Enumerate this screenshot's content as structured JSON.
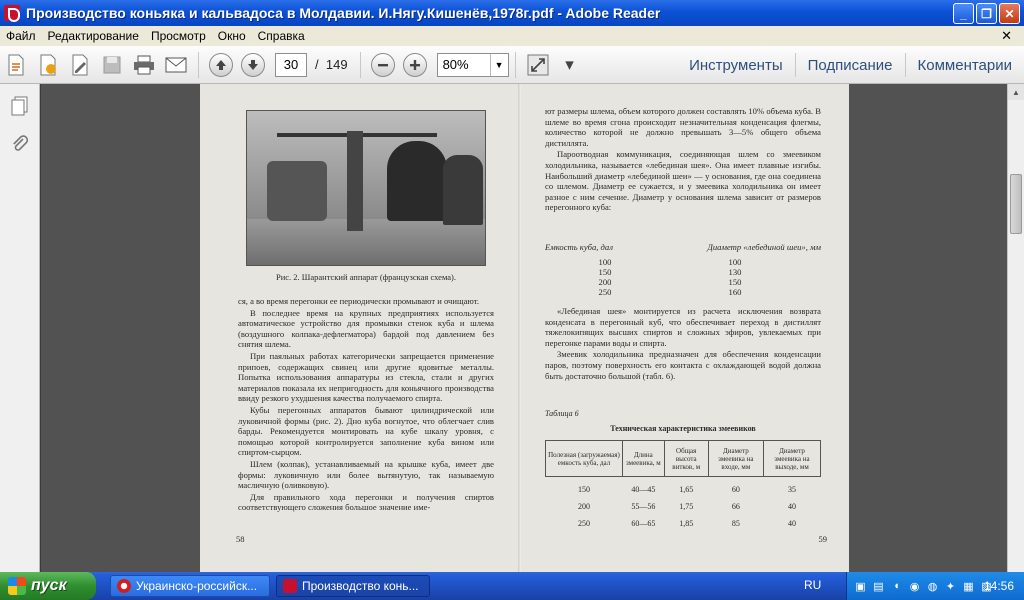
{
  "window": {
    "title": "Производство коньяка и кальвадоса в Молдавии. И.Нягу.Кишенёв,1978г.pdf - Adobe Reader",
    "min_glyph": "_",
    "max_glyph": "❐",
    "close_glyph": "✕"
  },
  "menu": {
    "items": [
      "Файл",
      "Редактирование",
      "Просмотр",
      "Окно",
      "Справка"
    ],
    "close_glyph": "✕"
  },
  "toolbar": {
    "page_current": "30",
    "page_separator": "/",
    "page_total": "149",
    "zoom_value": "80%",
    "zoom_dropdown_glyph": "▼",
    "more_glyph": "▾",
    "links": [
      "Инструменты",
      "Подписание",
      "Комментарии"
    ]
  },
  "left_page": {
    "caption": "Рис. 2. Шарантский аппарат (французская схема).",
    "paragraphs": [
      "ся, а во время перегонки ее периодически промывают и очищают.",
      "В последнее время на крупных предприятиях используется автоматическое устройство для промывки стенок куба и шлема (воздушного колпака-дефлегматора) бардой под давлением без снятия шлема.",
      "При паяльных работах категорически запрещается применение припоев, содержащих свинец или другие ядовитые металлы. Попытка использования аппаратуры из стекла, стали и других материалов показала их непригодность для коньячного производства ввиду резкого ухудшения качества получаемого спирта.",
      "Кубы перегонных аппаратов бывают цилиндрической или луковичной формы (рис. 2). Дно куба вогнутое, что облегчает слив барды. Рекомендуется монтировать на кубе шкалу уровня, с помощью которой контролируется заполнение куба вином или спиртом-сырцом.",
      "Шлем (колпак), устанавливаемый на крышке куба, имеет две формы: луковичную или более вытянутую, так называемую масличную (оливковую).",
      "Для правильного хода перегонки и получения спиртов соответствующего сложения большое значение име-"
    ],
    "page_number": "58"
  },
  "right_page": {
    "paragraphs_top": [
      "ют размеры шлема, объем которого должен составлять 10% объема куба. В шлеме во время сгона происходит незначительная конденсация флегмы, количество которой не должно превышать 3—5% общего объема дистиллята.",
      "Пароотводная коммуникация, соединяющая шлем со змеевиком холодильника, называется «лебединая шея». Она имеет плавные изгибы. Наибольший диаметр «лебединой шеи» — у основания, где она соединена со шлемом. Диаметр ее сужается, и у змеевика холодильника он имеет разное с ним сечение. Диаметр у основания шлема зависит от размеров перегонного куба:"
    ],
    "volume_table": {
      "col1": "Емкость куба, дал",
      "col2": "Диаметр «лебединой шеи», мм",
      "rows": [
        [
          "100",
          "100"
        ],
        [
          "150",
          "130"
        ],
        [
          "200",
          "150"
        ],
        [
          "250",
          "160"
        ]
      ]
    },
    "paragraphs_mid": [
      "«Лебединая шея» монтируется из расчета исключения возврата конденсата в перегонный куб, что обеспечивает переход в дистиллят тяжелокипящих высших спиртов и сложных эфиров, увлекаемых при перегонке парами воды и спирта.",
      "Змеевик холодильника предназначен для обеспечения конденсации паров, поэтому поверхность его контакта с охлаждающей водой должна быть достаточно большой (табл. 6)."
    ],
    "table_label": "Таблица 6",
    "table_title": "Техническая характеристика змеевиков",
    "spec_headers": [
      "Полезная (загружаемая) емкость куба, дал",
      "Длина змеевика, м",
      "Общая высота витков, м",
      "Диаметр змеевика на входе, мм",
      "Диаметр змеевика на выходе, мм"
    ],
    "spec_rows": [
      [
        "150",
        "40—45",
        "1,65",
        "60",
        "35"
      ],
      [
        "200",
        "55—56",
        "1,75",
        "66",
        "40"
      ],
      [
        "250",
        "60—65",
        "1,85",
        "85",
        "40"
      ]
    ],
    "page_number": "59"
  },
  "taskbar": {
    "start_label": "пуск",
    "items": [
      "Украинско-российск...",
      "Производство конь..."
    ],
    "lang": "RU",
    "clock": "14:56"
  }
}
